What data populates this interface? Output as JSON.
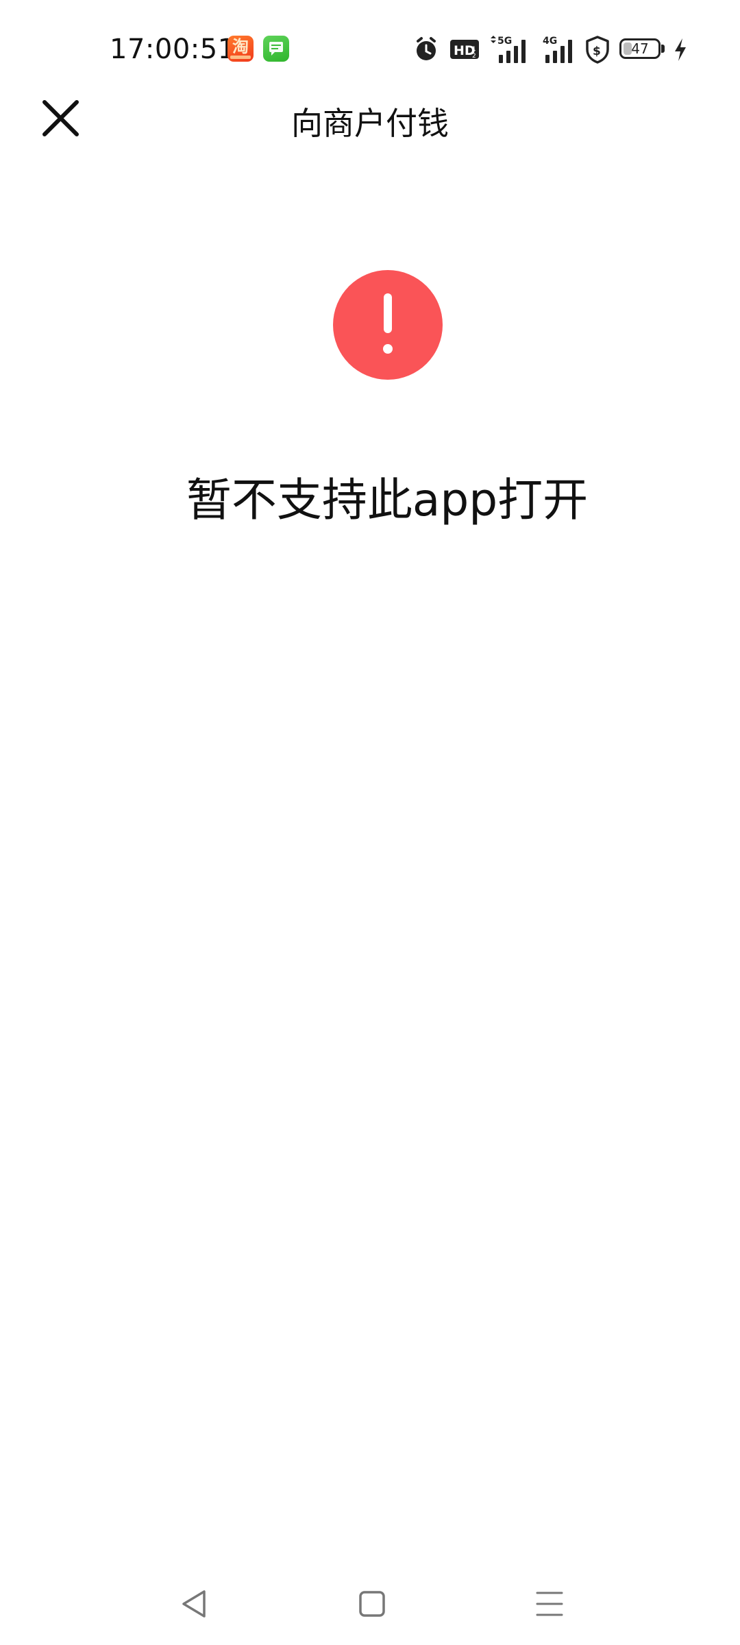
{
  "status_bar": {
    "time": "17:00:51",
    "notifications": [
      {
        "name": "taobao-app-icon",
        "glyph": "淘"
      },
      {
        "name": "messages-app-icon"
      }
    ],
    "indicators": {
      "hd_label": "HD",
      "network_primary": "5G",
      "network_secondary": "4G",
      "battery_percent": "47",
      "charging": true
    }
  },
  "header": {
    "title": "向商户付钱",
    "close_icon": "close-icon"
  },
  "main": {
    "error_icon": "exclamation-circle-icon",
    "error_color": "#fa5457",
    "message": "暂不支持此app打开"
  },
  "nav_bar": {
    "back_icon": "back-triangle-icon",
    "home_icon": "home-square-icon",
    "menu_icon": "menu-lines-icon"
  }
}
